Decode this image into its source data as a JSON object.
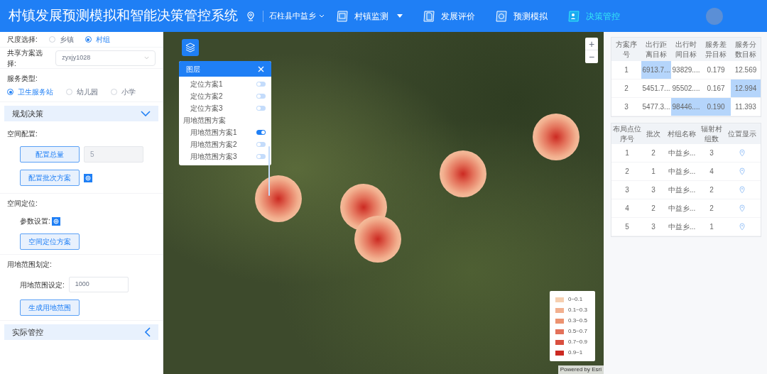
{
  "header": {
    "title": "村镇发展预测模拟和智能决策管控系统",
    "region": "石柱县中益乡",
    "nav": [
      {
        "label": "村镇监测",
        "selected": false,
        "dropdown": true
      },
      {
        "label": "发展评价",
        "selected": false,
        "dropdown": false
      },
      {
        "label": "预测模拟",
        "selected": false,
        "dropdown": false
      },
      {
        "label": "决策管控",
        "selected": true,
        "dropdown": false
      }
    ]
  },
  "left_panel": {
    "scale": {
      "label": "尺度选择:",
      "options": [
        {
          "label": "乡镇",
          "selected": false
        },
        {
          "label": "村组",
          "selected": true
        }
      ]
    },
    "shared_plan": {
      "label": "共享方案选择:",
      "value": "zyxjy1028"
    },
    "service_type": {
      "label": "服务类型:",
      "options": [
        {
          "label": "卫生服务站",
          "selected": true
        },
        {
          "label": "幼儿园",
          "selected": false
        },
        {
          "label": "小学",
          "selected": false
        }
      ]
    },
    "planning_section": {
      "title": "规划决策",
      "expanded": true
    },
    "spatial_config": {
      "label": "空间配置:",
      "total_button": "配置总量",
      "total_value": "5",
      "batch_button": "配置批次方案"
    },
    "spatial_location": {
      "label": "空间定位:",
      "param_label": "参数设置:",
      "button": "空间定位方案"
    },
    "land_range": {
      "label": "用地范围划定:",
      "field_label": "用地范围设定:",
      "value": "1000",
      "button": "生成用地范围"
    },
    "control_section": {
      "title": "实际管控",
      "expanded": false
    }
  },
  "layers_panel": {
    "title": "图层",
    "items": [
      {
        "kind": "layer",
        "label": "定位方案1",
        "on": false
      },
      {
        "kind": "layer",
        "label": "定位方案2",
        "on": false
      },
      {
        "kind": "layer",
        "label": "定位方案3",
        "on": false
      },
      {
        "kind": "group",
        "label": "用地范围方案"
      },
      {
        "kind": "layer",
        "label": "用地范围方案1",
        "on": true
      },
      {
        "kind": "layer",
        "label": "用地范围方案2",
        "on": false
      },
      {
        "kind": "layer",
        "label": "用地范围方案3",
        "on": false
      }
    ]
  },
  "legend": [
    {
      "label": "0~0.1",
      "color": "#f6cfb0"
    },
    {
      "label": "0.1~0.3",
      "color": "#f2b08f"
    },
    {
      "label": "0.3~0.5",
      "color": "#ec9270"
    },
    {
      "label": "0.5~0.7",
      "color": "#e3715a"
    },
    {
      "label": "0.7~0.9",
      "color": "#d94f3f"
    },
    {
      "label": "0.9~1",
      "color": "#cc2a22"
    }
  ],
  "attribution": "Powered by Esri",
  "zoom_controls": [
    "+",
    "−"
  ],
  "plan_table": {
    "columns": [
      "方案序号",
      "出行距离目标",
      "出行时间目标",
      "服务差异目标",
      "服务分数目标"
    ],
    "rows": [
      {
        "cells": [
          {
            "text": "1",
            "highlighted": false
          },
          {
            "text": "6913.7...",
            "highlighted": true
          },
          {
            "text": "93829....",
            "highlighted": false
          },
          {
            "text": "0.179",
            "highlighted": false
          },
          {
            "text": "12.569",
            "highlighted": false
          }
        ]
      },
      {
        "cells": [
          {
            "text": "2",
            "highlighted": false
          },
          {
            "text": "5451.7...",
            "highlighted": false
          },
          {
            "text": "95502....",
            "highlighted": false
          },
          {
            "text": "0.167",
            "highlighted": false
          },
          {
            "text": "12.994",
            "highlighted": true
          }
        ]
      },
      {
        "cells": [
          {
            "text": "3",
            "highlighted": false
          },
          {
            "text": "5477.3...",
            "highlighted": false
          },
          {
            "text": "98446....",
            "highlighted": true
          },
          {
            "text": "0.190",
            "highlighted": true
          },
          {
            "text": "11.393",
            "highlighted": false
          }
        ]
      }
    ]
  },
  "layout_table": {
    "columns": [
      "布局点位序号",
      "批次",
      "村组名称",
      "辐射村组数",
      "位置显示"
    ],
    "rows": [
      [
        "1",
        "2",
        "中益乡...",
        "3"
      ],
      [
        "2",
        "1",
        "中益乡...",
        "4"
      ],
      [
        "3",
        "3",
        "中益乡...",
        "2"
      ],
      [
        "4",
        "2",
        "中益乡...",
        "2"
      ],
      [
        "5",
        "3",
        "中益乡...",
        "1"
      ]
    ]
  }
}
